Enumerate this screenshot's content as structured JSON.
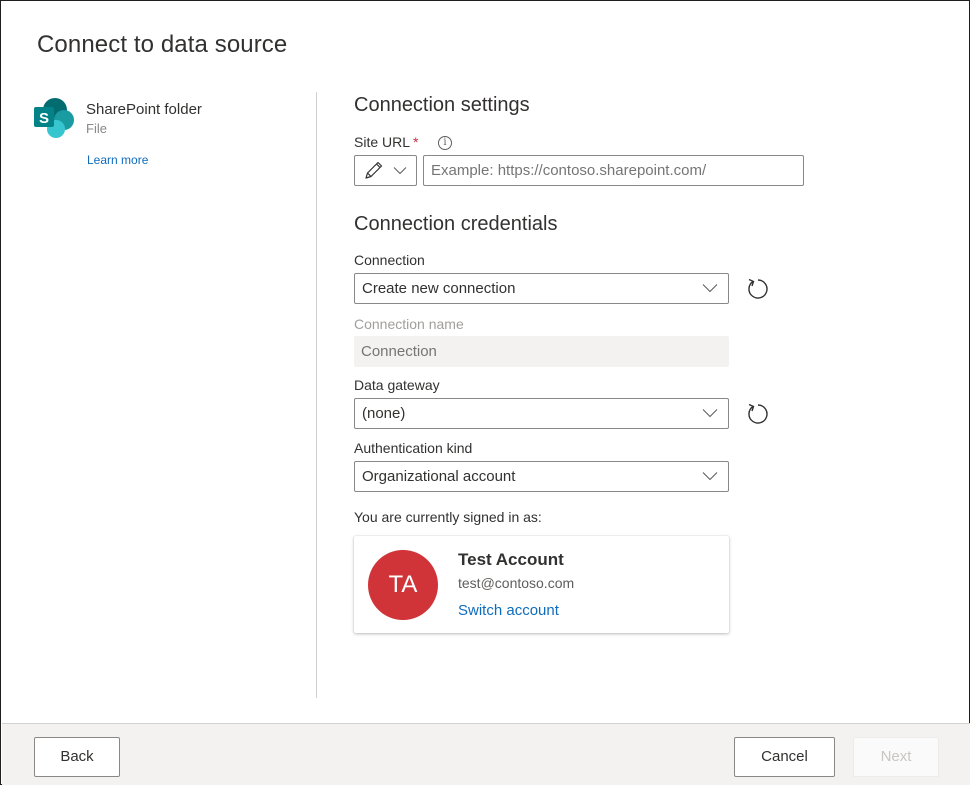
{
  "dialog": {
    "title": "Connect to data source"
  },
  "connector": {
    "name": "SharePoint folder",
    "type": "File",
    "learn_more": "Learn more",
    "icon": "sharepoint-logo-icon",
    "logo_letter": "S",
    "colors": {
      "dark": "#036c70",
      "mid": "#1a9ba1",
      "light": "#37c6d0",
      "tile": "#038387"
    }
  },
  "connection_settings": {
    "heading": "Connection settings",
    "site_url": {
      "label": "Site URL",
      "required_marker": "*",
      "info_icon": "info-icon",
      "picker_icon": "pencil-icon",
      "value": "",
      "placeholder": "Example: https://contoso.sharepoint.com/"
    }
  },
  "connection_credentials": {
    "heading": "Connection credentials",
    "connection": {
      "label": "Connection",
      "selected": "Create new connection"
    },
    "connection_name": {
      "label": "Connection name",
      "placeholder": "Connection",
      "disabled": true
    },
    "data_gateway": {
      "label": "Data gateway",
      "selected": "(none)"
    },
    "authentication_kind": {
      "label": "Authentication kind",
      "selected": "Organizational account"
    },
    "signed_in_label": "You are currently signed in as:",
    "account": {
      "initials": "TA",
      "name": "Test Account",
      "email": "test@contoso.com",
      "switch_label": "Switch account",
      "avatar_color": "#d13438"
    }
  },
  "footer": {
    "back_label": "Back",
    "cancel_label": "Cancel",
    "next_label": "Next",
    "next_disabled": true
  }
}
